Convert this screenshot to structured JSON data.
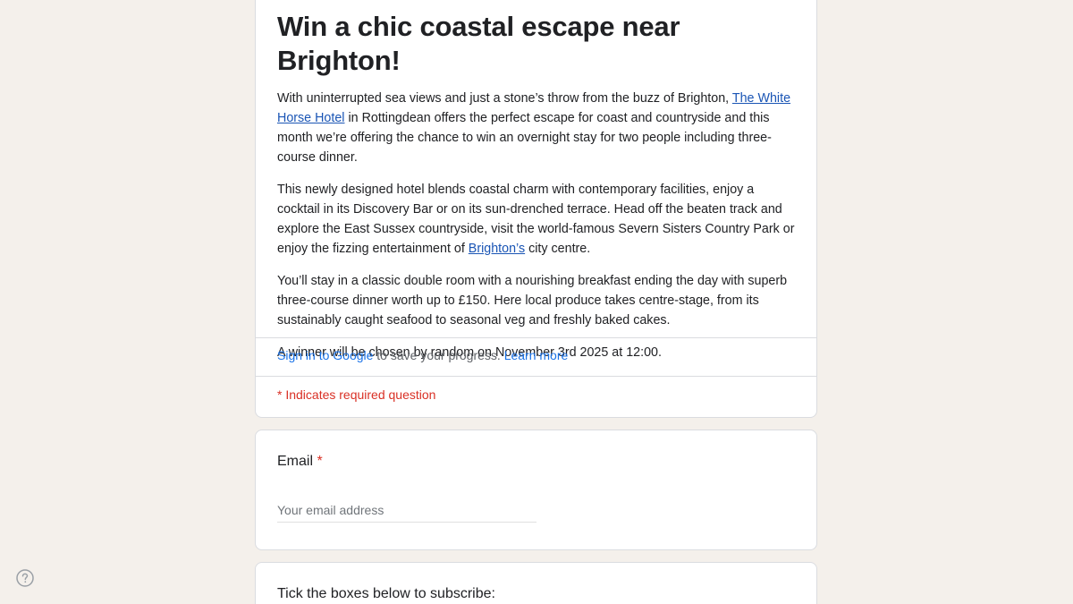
{
  "form": {
    "title": "Win a chic coastal escape near Brighton!",
    "description": {
      "p1_before": "With uninterrupted sea views and just a stone’s throw from the buzz of Brighton, ",
      "p1_link": "The White Horse Hotel",
      "p1_after": " in Rottingdean offers the perfect escape for coast and countryside and this month we’re offering the chance to win an overnight stay for two people including three-course dinner.",
      "p2_before": "This newly designed hotel blends coastal charm with contemporary facilities, enjoy a cocktail in its Discovery Bar or on its sun-drenched terrace. Head off the beaten track and explore the East Sussex countryside, visit the world-famous Severn Sisters Country Park or enjoy the fizzing entertainment of ",
      "p2_link": "Brighton’s",
      "p2_after": " city centre.",
      "p3": "You’ll stay in a classic double room with a nourishing breakfast ending the day with superb three-course dinner worth up to £150. Here local produce takes centre-stage, from its sustainably caught seafood to seasonal veg and freshly baked cakes.",
      "p4": "A winner will be chosen by random on November 3rd 2025 at 12:00."
    },
    "signin": {
      "link": "Sign in to Google",
      "text": " to save your progress. ",
      "learn_more": "Learn more"
    },
    "required_note": "* Indicates required question"
  },
  "email_question": {
    "label": "Email",
    "required_mark": "*",
    "placeholder": "Your email address"
  },
  "subscribe_question": {
    "label": "Tick the boxes below to subscribe:"
  },
  "icons": {
    "help": "help-circle-icon"
  },
  "colors": {
    "background": "#f4f0eb",
    "link": "#1a73e8",
    "required": "#d93025"
  }
}
